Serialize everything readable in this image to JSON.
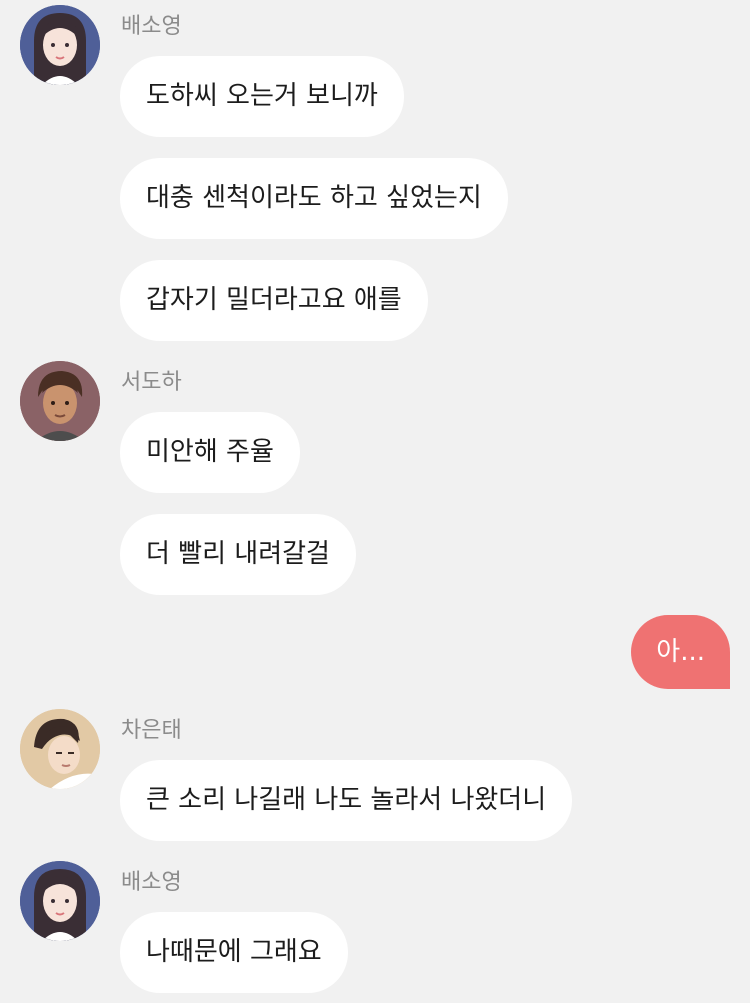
{
  "chat": {
    "messages": [
      {
        "sender": "배소영",
        "text": "도하씨 오는거 보니까"
      },
      {
        "text": "대충 센척이라도 하고 싶었는지"
      },
      {
        "text": "갑자기 밀더라고요 애를"
      },
      {
        "sender": "서도하",
        "text": "미안해 주율"
      },
      {
        "text": "더 빨리 내려갈걸"
      },
      {
        "mine": true,
        "text": "아..."
      },
      {
        "sender": "차은태",
        "text": "큰 소리 나길래 나도 놀라서 나왔더니"
      },
      {
        "sender": "배소영",
        "text": "나때문에 그래요"
      }
    ]
  },
  "colors": {
    "background": "#f1f1f1",
    "bubble_other": "#ffffff",
    "bubble_mine": "#ef7272",
    "sender_name": "#8b8b8b"
  }
}
